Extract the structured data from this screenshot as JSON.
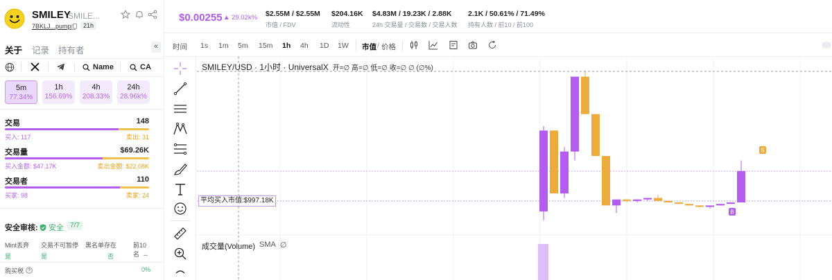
{
  "token": {
    "symbol": "SMILEY",
    "full_name": "SMILE...",
    "address": "7BKLJ...pump",
    "age": "21h"
  },
  "sidebar": {
    "tabs": [
      "关于",
      "记录",
      "持有者"
    ],
    "collapse_glyph": "«",
    "links": {
      "name_label": "Name",
      "ca_label": "CA"
    },
    "timeframes": [
      {
        "label": "5m",
        "change": "77.34%"
      },
      {
        "label": "1h",
        "change": "156.69%"
      },
      {
        "label": "4h",
        "change": "208.33%"
      },
      {
        "label": "24h",
        "change": "28.96k%"
      }
    ],
    "stats": [
      {
        "label": "交易",
        "value": "148",
        "left": "买入: 117",
        "right": "卖出: 31",
        "buy_ratio": 0.79
      },
      {
        "label": "交易量",
        "value": "$69.26K",
        "left": "买入金额: $47.17K",
        "right": "卖出金额: $22.08K",
        "buy_ratio": 0.68
      },
      {
        "label": "交易者",
        "value": "110",
        "left": "买家: 98",
        "right": "卖家: 24",
        "buy_ratio": 0.8
      }
    ],
    "audit": {
      "label": "安全审核:",
      "status": "安全",
      "count": "7/7",
      "headers": [
        "Mint丢弃",
        "交易不可暂停",
        "黑名单存在",
        "前10名"
      ],
      "values": [
        "是",
        "是",
        "否",
        "--"
      ],
      "buy_tax_label": "购买税",
      "buy_tax_value": "0%"
    }
  },
  "topbar": {
    "price": "$0.00255",
    "price_change": "▲ 29.02k%",
    "stats": [
      {
        "value": "$2.55M / $2.55M",
        "label": "市值 / FDV"
      },
      {
        "value": "$204.16K",
        "label": "流动性"
      },
      {
        "value": "$4.83M / 19.23K / 2.88K",
        "label": "24h 交易量 / 交易数 / 交易人数"
      },
      {
        "value": "2.1K / 50.61% / 71.49%",
        "label": "持有人数 / 前10 / 前100"
      }
    ]
  },
  "toolbar": {
    "time_label": "时间",
    "intervals": [
      "1s",
      "1m",
      "5m",
      "15m",
      "1h",
      "4h",
      "1D",
      "1W"
    ],
    "active_interval": "1h",
    "mcap_label": "市值",
    "price_label": "价格",
    "sep": "/"
  },
  "chart": {
    "legend_title": "SMILEY/USD · 1小时 · UniversalX",
    "ohlc": "开=∅ 高=∅ 低=∅ 收=∅ ∅ (∅%)",
    "avg_buy_label": "平均买入市值:$997.18K",
    "volume_label": "成交量(Volume)",
    "sma_label": "SMA",
    "sma_value": "∅",
    "buy_marker": "B",
    "sell_marker": "S",
    "colors": {
      "up": "#b35cf0",
      "down": "#ecab3c",
      "volume": "#dcbff7"
    }
  },
  "chart_data": {
    "type": "candlestick",
    "title": "SMILEY/USD · 1小时 · UniversalX",
    "y_unit": "market cap (USD), relative",
    "candles": [
      {
        "o": 0.06,
        "h": 0.63,
        "l": 0.0,
        "c": 0.6
      },
      {
        "o": 0.6,
        "h": 0.6,
        "l": 0.18,
        "c": 0.18
      },
      {
        "o": 0.18,
        "h": 0.49,
        "l": 0.15,
        "c": 0.46
      },
      {
        "o": 0.46,
        "h": 0.9,
        "l": 0.4,
        "c": 0.96
      },
      {
        "o": 0.96,
        "h": 1.0,
        "l": 0.71,
        "c": 0.71
      },
      {
        "o": 0.71,
        "h": 0.71,
        "l": 0.43,
        "c": 0.43
      },
      {
        "o": 0.43,
        "h": 0.43,
        "l": 0.1,
        "c": 0.1
      },
      {
        "o": 0.1,
        "h": 0.1,
        "l": 0.05,
        "c": 0.14
      },
      {
        "o": 0.14,
        "h": 0.14,
        "l": 0.12,
        "c": 0.13
      },
      {
        "o": 0.13,
        "h": 0.14,
        "l": 0.12,
        "c": 0.14
      },
      {
        "o": 0.14,
        "h": 0.15,
        "l": 0.13,
        "c": 0.15
      },
      {
        "o": 0.15,
        "h": 0.17,
        "l": 0.13,
        "c": 0.13
      },
      {
        "o": 0.13,
        "h": 0.13,
        "l": 0.12,
        "c": 0.12
      },
      {
        "o": 0.12,
        "h": 0.12,
        "l": 0.11,
        "c": 0.11
      },
      {
        "o": 0.11,
        "h": 0.11,
        "l": 0.1,
        "c": 0.1
      },
      {
        "o": 0.1,
        "h": 0.1,
        "l": 0.09,
        "c": 0.09
      },
      {
        "o": 0.09,
        "h": 0.1,
        "l": 0.08,
        "c": 0.1
      },
      {
        "o": 0.1,
        "h": 0.11,
        "l": 0.1,
        "c": 0.11
      },
      {
        "o": 0.11,
        "h": 0.12,
        "l": 0.11,
        "c": 0.12
      },
      {
        "o": 0.12,
        "h": 0.4,
        "l": 0.12,
        "c": 0.33
      }
    ],
    "avg_buy_market_cap": "$997.18K"
  }
}
